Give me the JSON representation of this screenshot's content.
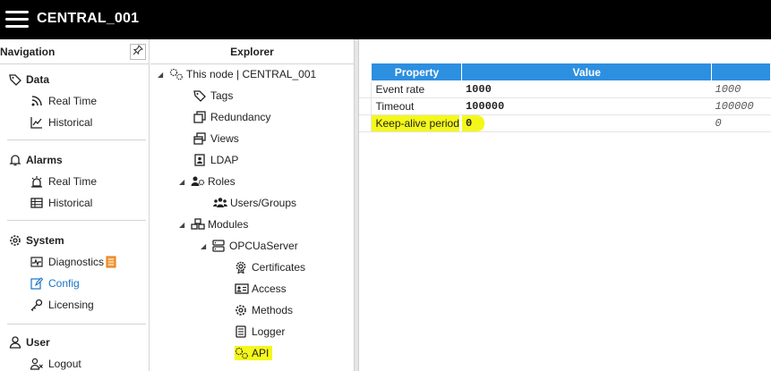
{
  "app": {
    "title": "CENTRAL_001"
  },
  "navigation": {
    "header": "Navigation",
    "groups": [
      {
        "title": "Data",
        "icon": "tag-icon",
        "items": [
          {
            "label": "Real Time",
            "icon": "rss-icon"
          },
          {
            "label": "Historical",
            "icon": "line-chart-icon"
          }
        ]
      },
      {
        "title": "Alarms",
        "icon": "bell-icon",
        "items": [
          {
            "label": "Real Time",
            "icon": "alarm-light-icon"
          },
          {
            "label": "Historical",
            "icon": "table-icon"
          }
        ]
      },
      {
        "title": "System",
        "icon": "gear-icon",
        "items": [
          {
            "label": "Diagnostics",
            "icon": "pulse-icon"
          },
          {
            "label": "Config",
            "icon": "edit-icon"
          },
          {
            "label": "Licensing",
            "icon": "key-icon"
          }
        ]
      },
      {
        "title": "User",
        "icon": "user-icon",
        "items": [
          {
            "label": "Logout",
            "icon": "user-x-icon"
          }
        ]
      }
    ]
  },
  "explorer": {
    "header": "Explorer",
    "tree": [
      {
        "label": "This node | CENTRAL_001"
      },
      {
        "label": "Tags"
      },
      {
        "label": "Redundancy"
      },
      {
        "label": "Views"
      },
      {
        "label": "LDAP"
      },
      {
        "label": "Roles"
      },
      {
        "label": "Users/Groups"
      },
      {
        "label": "Modules"
      },
      {
        "label": "OPCUaServer"
      },
      {
        "label": "Certificates"
      },
      {
        "label": "Access"
      },
      {
        "label": "Methods"
      },
      {
        "label": "Logger"
      },
      {
        "label": "API"
      }
    ]
  },
  "grid": {
    "columns": {
      "property": "Property",
      "value": "Value",
      "default": ""
    },
    "rows": [
      {
        "property": "Event rate",
        "value": "1000",
        "default": "1000"
      },
      {
        "property": "Timeout",
        "value": "100000",
        "default": "100000"
      },
      {
        "property": "Keep-alive period",
        "value": "0",
        "default": "0"
      }
    ]
  },
  "colors": {
    "topbar": "#000000",
    "accent": "#2d8fe0",
    "highlight": "#f4f81a",
    "active_link": "#1a73c8"
  }
}
